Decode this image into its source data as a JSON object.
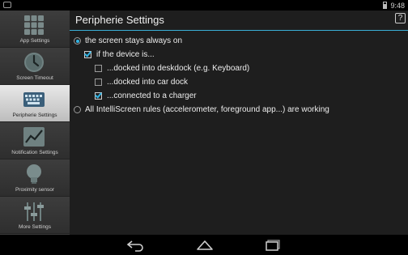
{
  "status_bar": {
    "time": "9:48"
  },
  "sidebar": {
    "items": [
      {
        "label": "App Settings",
        "icon": "grid-icon",
        "active": false
      },
      {
        "label": "Screen Timeout",
        "icon": "clock-icon",
        "active": false
      },
      {
        "label": "Peripherie Settings",
        "icon": "keyboard-icon",
        "active": true
      },
      {
        "label": "Notification Settings",
        "icon": "graph-icon",
        "active": false
      },
      {
        "label": "Proximity sensor",
        "icon": "bulb-icon",
        "active": false
      },
      {
        "label": "More Settings",
        "icon": "sliders-icon",
        "active": false
      }
    ]
  },
  "main": {
    "title": "Peripherie Settings",
    "help_label": "?",
    "options": {
      "always_on": {
        "label": "the screen stays always on",
        "selected": true
      },
      "if_device": {
        "label": "if the device is...",
        "checked": true
      },
      "deskdock": {
        "label": "...docked into deskdock (e.g. Keyboard)",
        "checked": false
      },
      "car_dock": {
        "label": "...docked into car dock",
        "checked": false
      },
      "charger": {
        "label": "...connected to a charger",
        "checked": true
      },
      "all_rules": {
        "label": "All IntelliScreen rules (accelerometer, foreground app...) are working",
        "selected": false
      }
    }
  },
  "colors": {
    "accent": "#33b5e5",
    "active_tab": "#d4d4d4"
  },
  "navbar": {
    "icons": [
      "back-icon",
      "home-icon",
      "recents-icon"
    ]
  }
}
